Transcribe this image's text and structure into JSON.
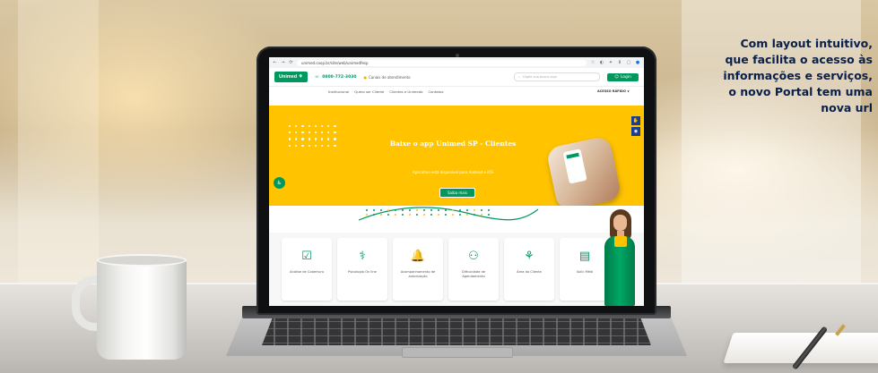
{
  "headline": {
    "line1": "Com layout intuitivo,",
    "line2": "que facilita o acesso às",
    "line3": "informações e serviços,",
    "line4": "o novo Portal tem uma",
    "line5": "nova url"
  },
  "browser": {
    "back_icon": "←",
    "forward_icon": "→",
    "reload_icon": "⟳",
    "url": "unimed.coop.br/site/web/unimedfesp",
    "toolbar_icons": [
      "☆",
      "◐",
      "✦",
      "⬇",
      "▢",
      "●"
    ]
  },
  "site": {
    "logo_text": "Unimed ",
    "phone": "0800-772-3030",
    "canal_label": "Canais de atendimento",
    "search_placeholder": "Digite sua busca aqui",
    "login_label": "Login",
    "menu": [
      "Institucional",
      "Quero ser Cliente",
      "Clientes e Unimedo",
      "Contatos"
    ],
    "menu_right": "ACESSO RÁPIDO ∨",
    "hero_title": "Baixe o app Unimed SP - Clientes",
    "hero_subtitle": "Aplicativo está disponível para Android e iOS",
    "hero_button": "Saiba mais",
    "services": [
      {
        "icon": "☑",
        "label": "Análise de Cobertura"
      },
      {
        "icon": "⚕",
        "label": "Psicologia On line"
      },
      {
        "icon": "🔔",
        "label": "Acompanhamento de autorização"
      },
      {
        "icon": "⚇",
        "label": "Dificuldade de Agendamento"
      },
      {
        "icon": "⚘",
        "label": "Área do Cliente"
      },
      {
        "icon": "▤",
        "label": "Solic Médi"
      }
    ]
  },
  "colors": {
    "brand_green": "#00995d",
    "hero_yellow": "#ffc300",
    "headline_navy": "#0a1f4a"
  }
}
